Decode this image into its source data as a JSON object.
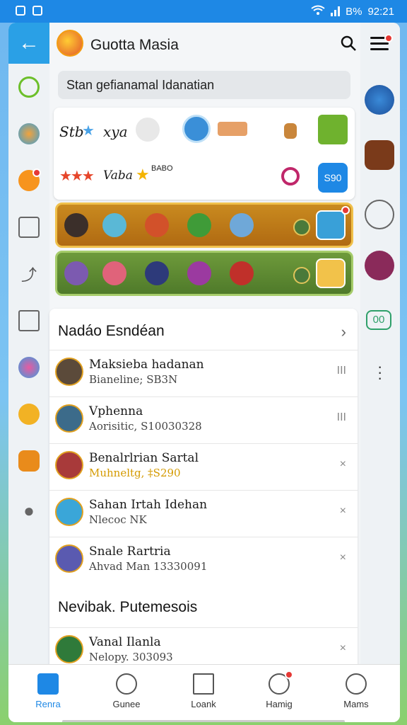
{
  "statusbar": {
    "battery": "B%",
    "time": "92:21"
  },
  "header": {
    "title": "Guotta Masia"
  },
  "search": {
    "placeholder": "Stan gefianamal Idanatian"
  },
  "cards": {
    "row1": {
      "text1": "Stb",
      "text2": "xya"
    },
    "row2": {
      "text1": "Vaba",
      "text2": "BABO",
      "button_label": "S90"
    }
  },
  "section1": {
    "title": "Nadáo Esndéan"
  },
  "list": [
    {
      "name": "Maksieba hadanan",
      "sub": "Bianeline; SB3N",
      "action": "III"
    },
    {
      "name": "Vphenna",
      "sub": "Aorisitic, S10030328",
      "action": "III"
    },
    {
      "name": "Benalrlrian Sartal",
      "sub": "Muhneltg, ‡S290",
      "action": "×"
    },
    {
      "name": "Sahan Irtah Idehan",
      "sub": "Nlecoc NK",
      "action": "×"
    },
    {
      "name": "Snale Rartria",
      "sub": "Ahvad Man 13330091",
      "action": "×"
    }
  ],
  "section2": {
    "title": "Nevibak. Putemesois"
  },
  "list2": [
    {
      "name": "Vanal Ilanla",
      "sub": "Nelopy. 303093",
      "action": "×"
    }
  ],
  "bottom_nav": [
    {
      "label": "Renra"
    },
    {
      "label": "Gunee"
    },
    {
      "label": "Loank"
    },
    {
      "label": "Hamig"
    },
    {
      "label": "Mams"
    }
  ],
  "right_rail": {
    "pill_label": "00"
  },
  "colors": {
    "accent": "#1e88e5",
    "gold": "#d49a00",
    "badge": "#e53935"
  }
}
